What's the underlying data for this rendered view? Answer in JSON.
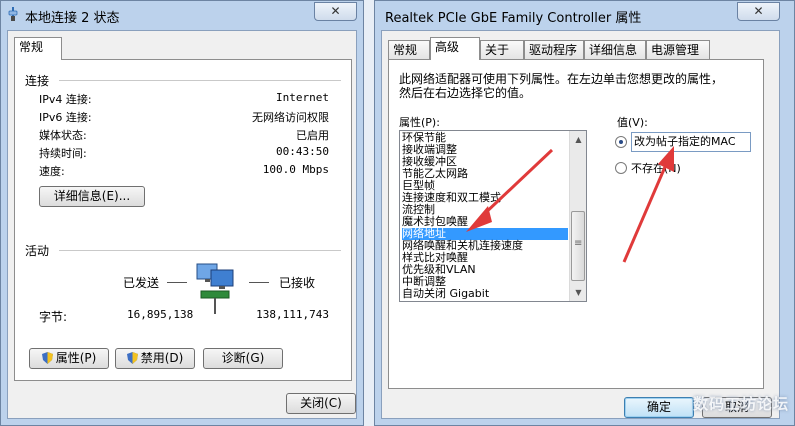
{
  "status_window": {
    "title": "本地连接 2 状态",
    "close_glyph": "✕",
    "tab_general": "常规",
    "connection_heading": "连接",
    "rows": [
      {
        "label": "IPv4 连接:",
        "value": "Internet"
      },
      {
        "label": "IPv6 连接:",
        "value": "无网络访问权限"
      },
      {
        "label": "媒体状态:",
        "value": "已启用"
      },
      {
        "label": "持续时间:",
        "value": "00:43:50"
      },
      {
        "label": "速度:",
        "value": "100.0 Mbps"
      }
    ],
    "details_button": "详细信息(E)...",
    "activity_heading": "活动",
    "sent_label": "已发送",
    "received_label": "已接收",
    "bytes_label": "字节:",
    "bytes_sent": "16,895,138",
    "bytes_received": "138,111,743",
    "properties_button": "属性(P)",
    "disable_button": "禁用(D)",
    "diagnose_button": "诊断(G)",
    "close_button": "关闭(C)"
  },
  "props_window": {
    "title": "Realtek PCIe GbE Family Controller 属性",
    "close_glyph": "✕",
    "tabs": [
      "常规",
      "高级",
      "关于",
      "驱动程序",
      "详细信息",
      "电源管理"
    ],
    "active_tab_index": 1,
    "description_line1": "此网络适配器可使用下列属性。在左边单击您想更改的属性，",
    "description_line2": "然后在右边选择它的值。",
    "property_label": "属性(P):",
    "value_label": "值(V):",
    "properties": [
      "环保节能",
      "接收端调整",
      "接收缓冲区",
      "节能乙太网路",
      "巨型帧",
      "连接速度和双工模式",
      "流控制",
      "魔术封包唤醒",
      "网络地址",
      "网络唤醒和关机连接速度",
      "样式比对唤醒",
      "优先级和VLAN",
      "中断调整",
      "自动关闭 Gigabit"
    ],
    "selected_property_index": 8,
    "value_text": "改为帖子指定的MAC",
    "not_present_label": "不存在(N)",
    "value_radio_selected": true,
    "ok_button": "确定",
    "cancel_button": "取消",
    "scroll_up_glyph": "▲",
    "scroll_down_glyph": "▼",
    "scroll_grip": "≡"
  },
  "watermark": "数码工坊论坛",
  "colors": {
    "annotation_arrow": "#e03a3a",
    "selection": "#3399ff",
    "frame": "#bcd2ec"
  }
}
